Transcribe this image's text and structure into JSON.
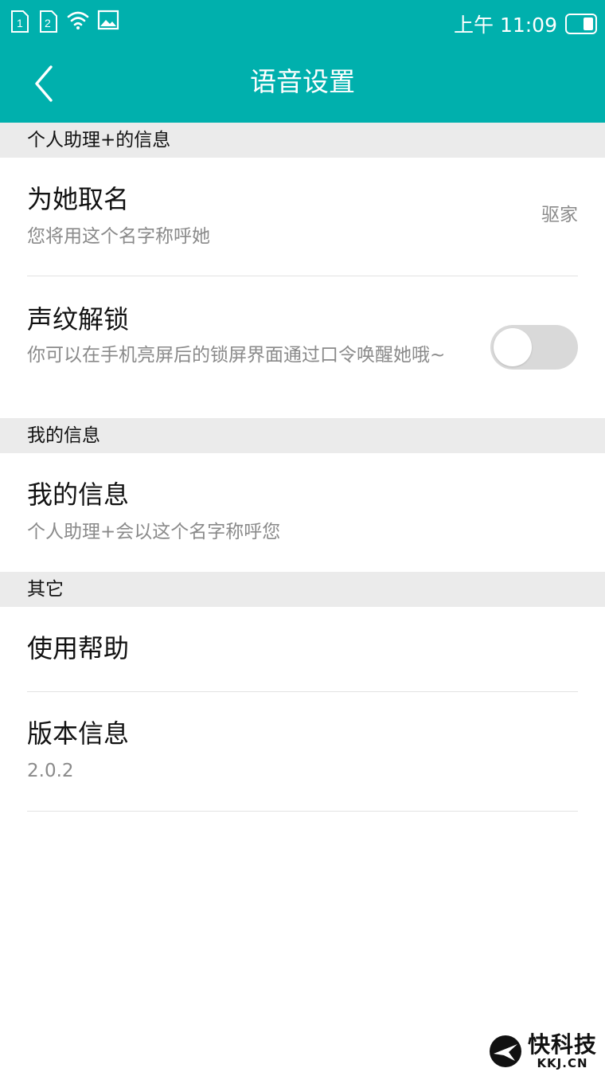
{
  "status_bar": {
    "sim1": "1",
    "sim2": "2",
    "time": "上午 11:09",
    "icons": [
      "sim1-icon",
      "sim2-icon",
      "wifi-icon",
      "image-icon",
      "battery-icon"
    ]
  },
  "header": {
    "title": "语音设置",
    "back_icon": "chevron-left-icon",
    "background": "#00b0ad"
  },
  "sections": {
    "assistant_header": "个人助理+的信息",
    "mine_header": "我的信息",
    "other_header": "其它"
  },
  "rows": {
    "name_her": {
      "title": "为她取名",
      "subtitle": "您将用这个名字称呼她",
      "value": "驱家"
    },
    "voice_unlock": {
      "title": "声纹解锁",
      "subtitle": "你可以在手机亮屏后的锁屏界面通过口令唤醒她哦~",
      "toggle_on": false
    },
    "my_info": {
      "title": "我的信息",
      "subtitle": "个人助理+会以这个名字称呼您"
    },
    "help": {
      "title": "使用帮助"
    },
    "version": {
      "title": "版本信息",
      "subtitle": "2.0.2"
    }
  },
  "watermark": {
    "brand_cn": "快科技",
    "brand_en": "KKJ.CN"
  }
}
